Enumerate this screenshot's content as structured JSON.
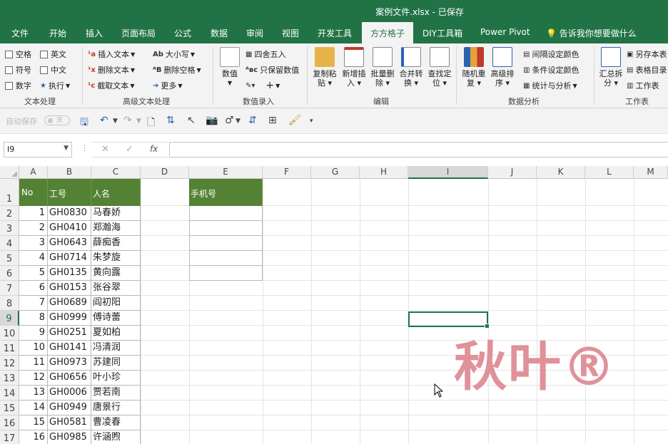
{
  "window": {
    "title": "案例文件.xlsx  -  已保存"
  },
  "tabs": [
    "文件",
    "开始",
    "插入",
    "页面布局",
    "公式",
    "数据",
    "审阅",
    "视图",
    "开发工具",
    "方方格子",
    "DIY工具箱",
    "Power Pivot"
  ],
  "active_tab": "方方格子",
  "tell_me": "告诉我你想要做什么",
  "ribbon": {
    "text_processing": {
      "label": "文本处理",
      "items": [
        "空格",
        "英文",
        "符号",
        "中文",
        "数字",
        "执行"
      ]
    },
    "advanced_text": {
      "label": "高级文本处理",
      "items": [
        "插入文本",
        "删除文本",
        "截取文本",
        "大小写",
        "删除空格",
        "更多"
      ]
    },
    "numeric_entry": {
      "label": "数值录入",
      "big": "数值",
      "items": [
        "四舍五入",
        "只保留数值"
      ]
    },
    "edit": {
      "label": "编辑",
      "buttons": [
        "复制粘贴",
        "新增插入",
        "批量删除",
        "合并转换",
        "查找定位"
      ]
    },
    "data_analysis": {
      "label": "数据分析",
      "buttons": [
        "随机重复",
        "高级排序"
      ],
      "items": [
        "间隔设定颜色",
        "条件设定颜色",
        "统计与分析"
      ]
    },
    "worksheet": {
      "label": "工作表",
      "big": "汇总拆分",
      "items": [
        "另存本表",
        "表格目录",
        "工作表"
      ]
    }
  },
  "qat": {
    "autosave": "自动保存",
    "toggle": "关"
  },
  "formula_bar": {
    "name_box": "I9",
    "fx": "fx",
    "value": ""
  },
  "sheet": {
    "columns": [
      "A",
      "B",
      "C",
      "D",
      "E",
      "F",
      "G",
      "H",
      "I",
      "J",
      "K",
      "L",
      "M"
    ],
    "selected_column": "I",
    "selected_row": "9",
    "row_numbers": [
      "1",
      "2",
      "3",
      "4",
      "5",
      "6",
      "7",
      "8",
      "9",
      "10",
      "11",
      "12",
      "13",
      "14",
      "15",
      "16",
      "17"
    ],
    "headers": {
      "A": "No",
      "B": "工号",
      "C": "人名",
      "E": "手机号"
    },
    "rows": [
      [
        "1",
        "GH0830",
        "马春娇"
      ],
      [
        "2",
        "GH0410",
        "郑瀚海"
      ],
      [
        "3",
        "GH0643",
        "薛痴香"
      ],
      [
        "4",
        "GH0714",
        "朱梦旋"
      ],
      [
        "5",
        "GH0135",
        "黄向露"
      ],
      [
        "6",
        "GH0153",
        "张谷翠"
      ],
      [
        "7",
        "GH0689",
        "阎初阳"
      ],
      [
        "8",
        "GH0999",
        "傅诗蕾"
      ],
      [
        "9",
        "GH0251",
        "夏如柏"
      ],
      [
        "10",
        "GH0141",
        "冯清润"
      ],
      [
        "11",
        "GH0973",
        "苏建同"
      ],
      [
        "12",
        "GH0656",
        "叶小珍"
      ],
      [
        "13",
        "GH0006",
        "贾若南"
      ],
      [
        "14",
        "GH0949",
        "唐景行"
      ],
      [
        "15",
        "GH0581",
        "曹凌春"
      ],
      [
        "16",
        "GH0985",
        "许涵煦"
      ]
    ]
  },
  "watermark": "秋叶®"
}
